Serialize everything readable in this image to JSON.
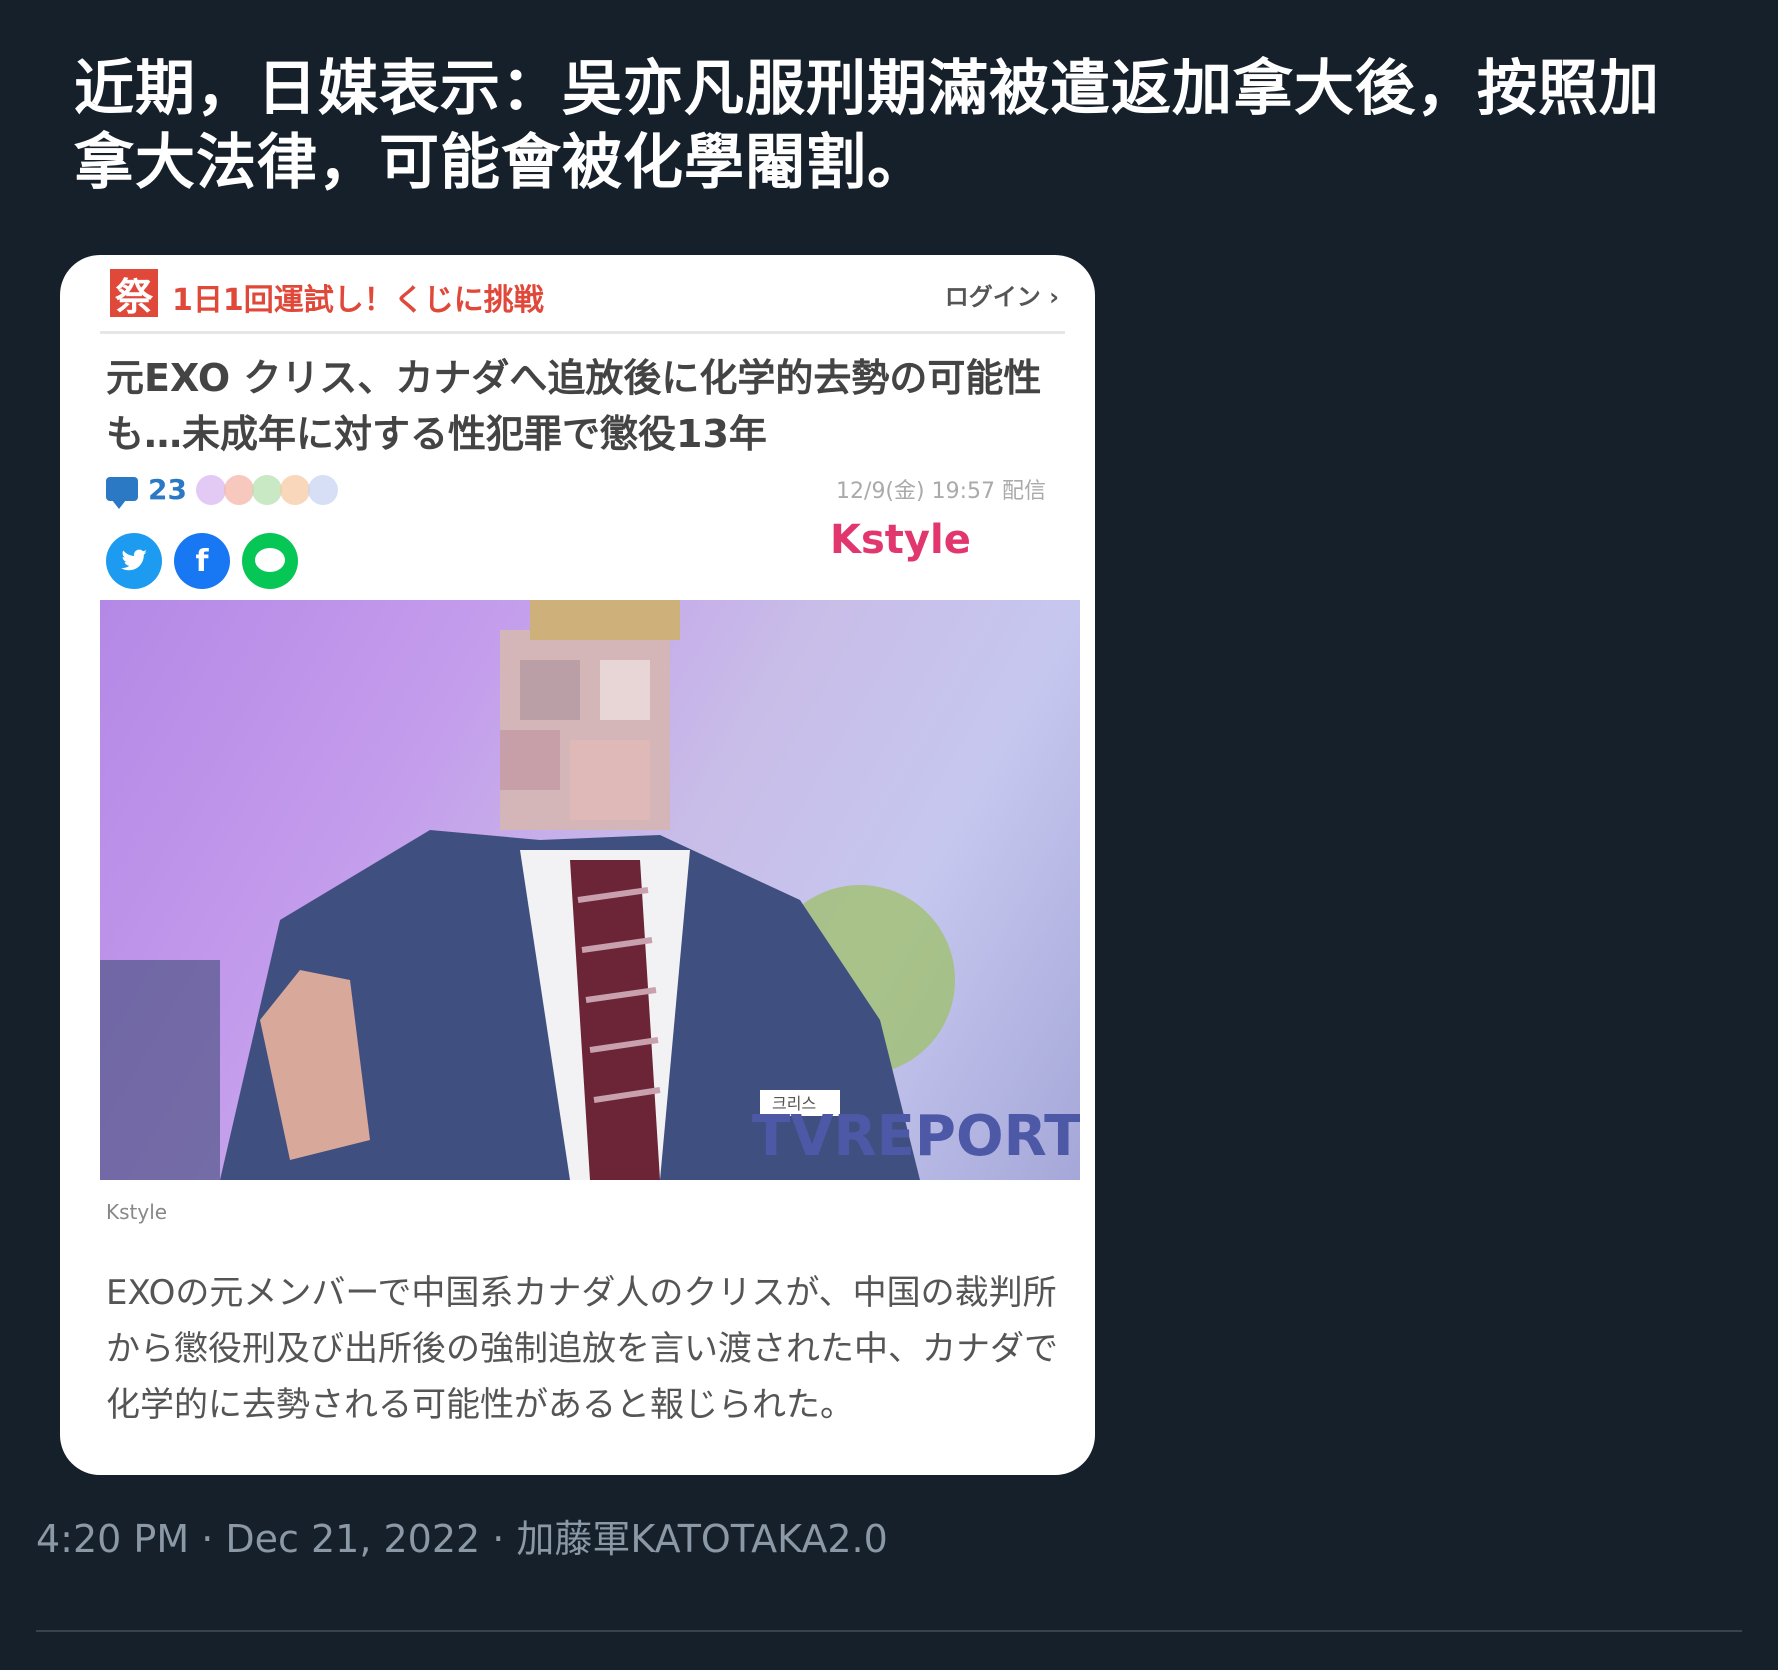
{
  "tweet": {
    "text": "近期，日媒表示：吳亦凡服刑期滿被遣返加拿大後，按照加拿大法律，可能會被化學閹割。",
    "timestamp": "4:20 PM · Dec 21, 2022 · 加藤軍KATOTAKA2.0"
  },
  "card": {
    "topbar": {
      "badge": "祭",
      "promo": "1日1回運試し！くじに挑戦",
      "login": "ログイン ›"
    },
    "headline": "元EXO クリス、カナダへ追放後に化学的去勢の可能性も…未成年に対する性犯罪で懲役13年",
    "comment_count": "23",
    "dateline": "12/9(金) 19:57 配信",
    "share_icons": [
      "twitter-icon",
      "facebook-icon",
      "line-icon"
    ],
    "source_logo": "Kstyle",
    "photo": {
      "watermark": "TVREPORT",
      "name_tag": "크리스",
      "credit": "Kstyle"
    },
    "body": "EXOの元メンバーで中国系カナダ人のクリスが、中国の裁判所から懲役刑及び出所後の強制追放を言い渡された中、カナダで化学的に去勢される可能性があると報じられた。"
  },
  "colors": {
    "background": "#15202b",
    "accent_red": "#e0483a",
    "kstyle_pink": "#e2366e",
    "link_blue": "#2b78c5"
  }
}
